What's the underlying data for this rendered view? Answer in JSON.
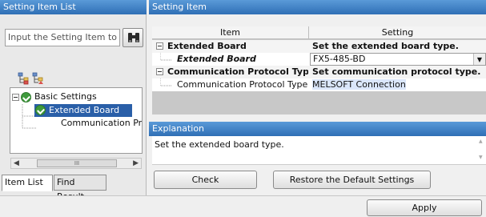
{
  "left": {
    "header": "Setting Item List",
    "search_placeholder": "Input the Setting Item to S",
    "tree": {
      "root": "Basic Settings",
      "child1": "Extended Board",
      "child2": "Communication Pro"
    },
    "scroll_thumb": "III",
    "tabs": [
      "Item List",
      "Find Result"
    ]
  },
  "right": {
    "header": "Setting Item",
    "columns": [
      "Item",
      "Setting"
    ],
    "rows": [
      {
        "item": "Extended Board",
        "setting": "Set the extended board type."
      },
      {
        "item": "Extended Board",
        "setting": "FX5-485-BD"
      },
      {
        "item": "Communication Protocol Type",
        "setting": "Set communication protocol type."
      },
      {
        "item": "Communication Protocol Type",
        "setting": "MELSOFT Connection"
      }
    ],
    "explanation_header": "Explanation",
    "explanation_text": "Set the extended board type.",
    "check_label": "Check",
    "restore_label": "Restore the Default Settings"
  },
  "apply_label": "Apply",
  "colors": {
    "header_blue": "#2f6fb5",
    "check_green": "#3f9a3c",
    "selected_blue": "#2a5fa8"
  },
  "icons": [
    "binoculars-icon",
    "expand-tree-icon",
    "sort-tree-icon",
    "check-circle-icon",
    "dropdown-arrow-icon",
    "collapse-icon"
  ]
}
